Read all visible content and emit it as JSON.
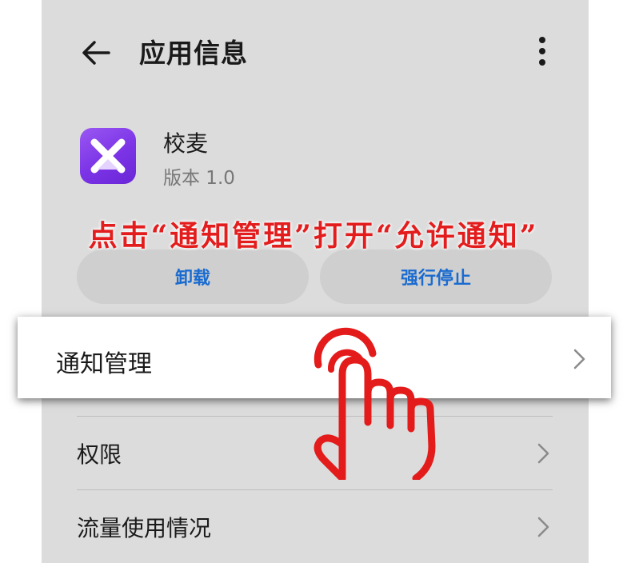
{
  "header": {
    "back_icon": "arrow-left-icon",
    "title": "应用信息",
    "more_icon": "more-vertical-icon"
  },
  "app": {
    "icon": "xiaomai-app-icon",
    "icon_colors": [
      "#9a57f2",
      "#6a27d6"
    ],
    "name": "校麦",
    "version": "版本 1.0"
  },
  "actions": {
    "uninstall_label": "卸载",
    "force_stop_label": "强行停止",
    "accent_color": "#1a6bd0"
  },
  "settings": {
    "notification_label": "通知管理",
    "permission_label": "权限",
    "data_usage_label": "流量使用情况",
    "chevron_icon": "chevron-right-icon"
  },
  "overlay": {
    "instruction": "点击“通知管理”打开“允许通知”",
    "instruction_color": "#e31d1d",
    "hand_icon": "tap-hand-icon"
  }
}
